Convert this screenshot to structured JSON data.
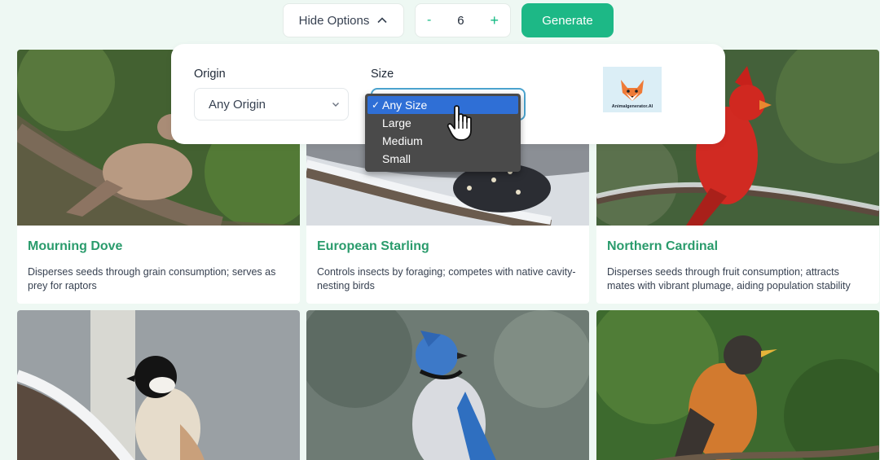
{
  "toolbar": {
    "hide_options_label": "Hide Options",
    "stepper": {
      "minus": "-",
      "value": "6",
      "plus": "+"
    },
    "generate_label": "Generate"
  },
  "options": {
    "origin_label": "Origin",
    "origin_value": "Any Origin",
    "size_label": "Size",
    "size_options": [
      {
        "label": "Any Size",
        "selected": true
      },
      {
        "label": "Large",
        "selected": false
      },
      {
        "label": "Medium",
        "selected": false
      },
      {
        "label": "Small",
        "selected": false
      }
    ],
    "logo_text": "Animalgenerator.AI"
  },
  "cards": [
    {
      "name": "Mourning Dove",
      "desc": "Disperses seeds through grain consumption; serves as prey for raptors"
    },
    {
      "name": "European Starling",
      "desc": "Controls insects by foraging; competes with native cavity-nesting birds"
    },
    {
      "name": "Northern Cardinal",
      "desc": "Disperses seeds through fruit consumption; attracts mates with vibrant plumage, aiding population stability"
    },
    {
      "name": "",
      "desc": ""
    },
    {
      "name": "",
      "desc": ""
    },
    {
      "name": "",
      "desc": ""
    }
  ],
  "colors": {
    "accent": "#1db886",
    "card_title": "#2a9b6c",
    "background": "#eef8f3",
    "dropdown_bg": "#4a4a4a",
    "dropdown_selected": "#2f6fd6"
  }
}
